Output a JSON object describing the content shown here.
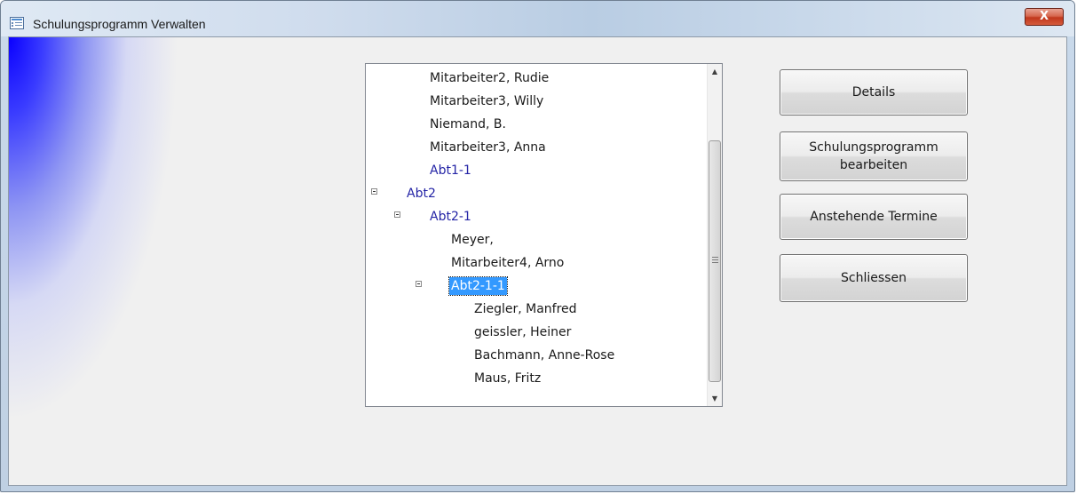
{
  "window": {
    "title": "Schulungsprogramm Verwalten",
    "close_glyph": "X"
  },
  "tree": {
    "nodes": [
      {
        "label": "Mitarbeiter2, Rudie",
        "type": "person"
      },
      {
        "label": "Mitarbeiter3, Willy",
        "type": "person"
      },
      {
        "label": "Niemand, B.",
        "type": "person"
      },
      {
        "label": "Mitarbeiter3, Anna",
        "type": "person"
      },
      {
        "label": "Abt1-1",
        "type": "group"
      },
      {
        "label": "Abt2",
        "type": "group",
        "expanded": true
      },
      {
        "label": "Abt2-1",
        "type": "group",
        "expanded": true
      },
      {
        "label": "Meyer,",
        "type": "person"
      },
      {
        "label": "Mitarbeiter4, Arno",
        "type": "person"
      },
      {
        "label": "Abt2-1-1",
        "type": "group",
        "expanded": true,
        "selected": true
      },
      {
        "label": "Ziegler, Manfred",
        "type": "person"
      },
      {
        "label": "geissler, Heiner",
        "type": "person"
      },
      {
        "label": "Bachmann, Anne-Rose",
        "type": "person"
      },
      {
        "label": "Maus, Fritz",
        "type": "person"
      }
    ],
    "scroll_up_glyph": "▲",
    "scroll_down_glyph": "▼"
  },
  "buttons": {
    "details": "Details",
    "edit_program": "Schulungsprogramm\nbearbeiten",
    "pending_dates": "Anstehende Termine",
    "close": "Schliessen"
  },
  "colors": {
    "group_text": "#2424a6",
    "selection": "#3399ff",
    "close_button": "#c1381d"
  },
  "icons": {
    "app": "form-icon",
    "close": "close-icon",
    "expander": "collapse-box-icon"
  }
}
